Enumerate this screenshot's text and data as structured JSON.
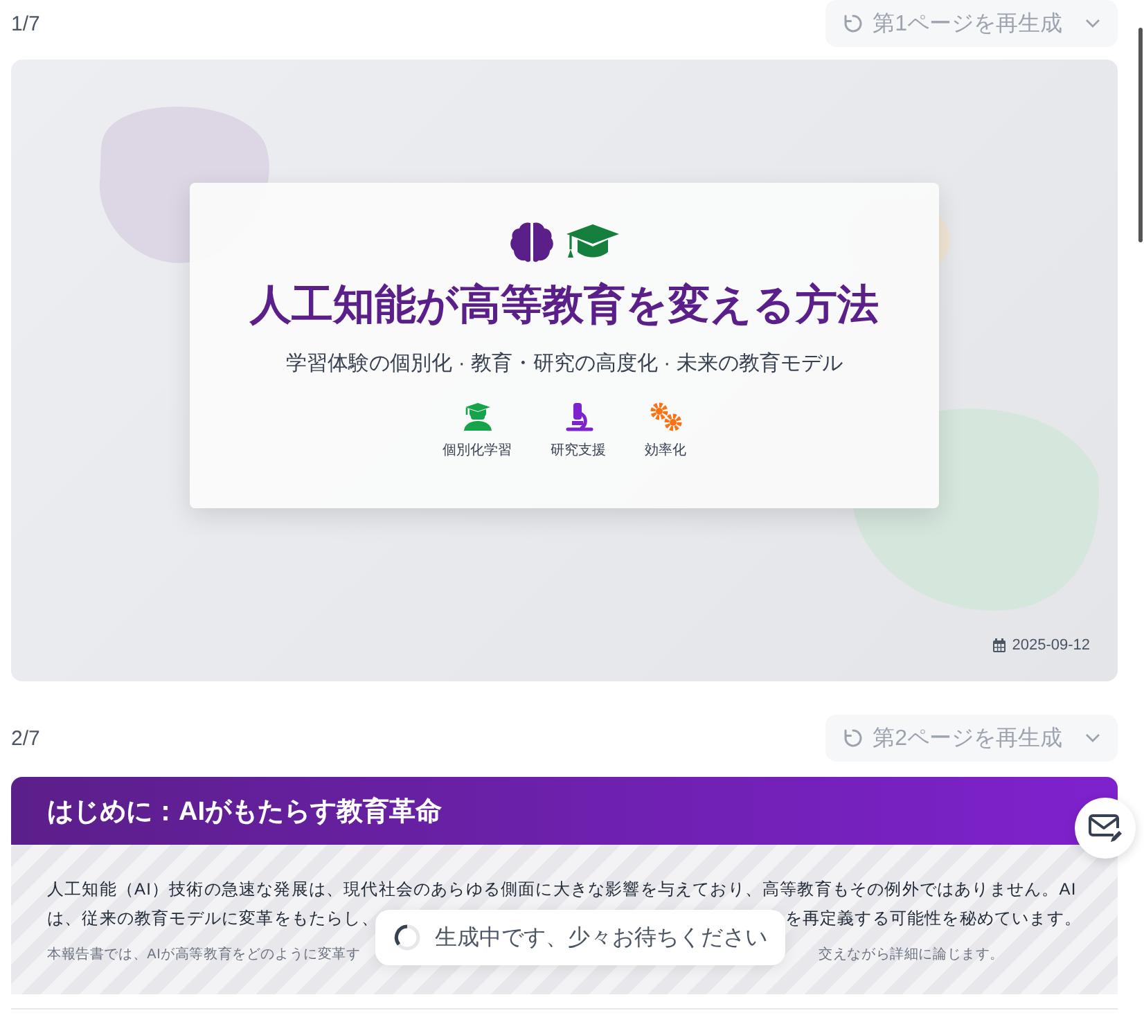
{
  "page_1": {
    "counter": "1/7",
    "regenerate_label": "第1ページを再生成",
    "slide": {
      "title": "人工知能が高等教育を変える方法",
      "subtitle": "学習体験の個別化 · 教育・研究の高度化 · 未来の教育モデル",
      "features": [
        {
          "kind": "student",
          "label": "個別化学習"
        },
        {
          "kind": "microscope",
          "label": "研究支援"
        },
        {
          "kind": "gears",
          "label": "効率化"
        }
      ],
      "date": "2025-09-12"
    }
  },
  "page_2": {
    "counter": "2/7",
    "regenerate_label": "第2ページを再生成",
    "slide": {
      "heading": "はじめに：AIがもたらす教育革命",
      "line_1": "人工知能（AI）技術の急速な発展は、現代社会のあらゆる側面に大きな影響を与えており、高等教育もその例外ではありません。AI",
      "line_2_start": "は、従来の教育モデルに変革をもたらし、",
      "line_2_end": "を再定義する可能性を秘めています。",
      "line_3_start": "本報告書では、AIが高等教育をどのように変革す",
      "line_3_end": "交えながら詳細に論じます。"
    }
  },
  "toast": {
    "message": "生成中です、少々お待ちください"
  }
}
